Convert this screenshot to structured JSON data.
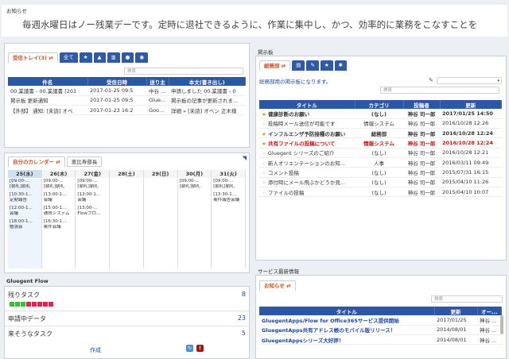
{
  "notice": {
    "label": "お知らせ",
    "message": "毎週水曜日はノー残業デーです。定時に退社できるように、作業に集中し、かつ、効率的に業務をこなすことを"
  },
  "mail": {
    "tabs": [
      "受信トレイ(3)",
      "全て"
    ],
    "icons": [
      "star-icon",
      "attach-icon",
      "trash-icon",
      "comment-icon",
      "settings-icon"
    ],
    "search_placeholder": "検索",
    "headers": [
      "件名",
      "受信日時",
      "送り主",
      "本文(書き出し)"
    ],
    "rows": [
      {
        "subject": "00.業議書 - 00.業議書 [201",
        "date": "2017-01-25 09:5",
        "from": "中谷 ...",
        "body": "申請しました 00.業議書 - 0"
      },
      {
        "subject": "掲示板 更新通知",
        "date": "2017-01-25 09:5",
        "from": "Glue...",
        "body": "掲示板の記事が更新されま..."
      },
      {
        "subject": "【外部】 通知: [未読] オベ",
        "date": "2017-01-23 16:2",
        "from": "Goog...",
        "body": "詳細 » [未読] オベン 正木様"
      }
    ]
  },
  "calendar": {
    "tabs": [
      "自分のカレンダー",
      "恵比寿部長"
    ],
    "days": [
      "25(水)",
      "26(木)",
      "27(金)",
      "28(土)",
      "29(日)",
      "30(月)",
      "31(火)"
    ],
    "events": [
      [
        "[09:00-...",
        "[朝礼]朝礼",
        "[10:30-1...",
        "定期報告",
        "[12:00-1...",
        "会議",
        "[18:00-1...",
        "勉強会"
      ],
      [
        "[09:00-...",
        "[朝礼]朝礼",
        "[13:00-1...",
        "会議",
        "[15:00-1...",
        "通貨システム",
        "[16:30-1...",
        "案件会議"
      ],
      [
        "[09:00-...",
        "[朝礼]朝礼",
        "[12:00-1...",
        "会議",
        "[13:00-...",
        "Flowプロ..."
      ],
      [],
      [],
      [
        "[09:00-...",
        "[朝礼]朝礼"
      ],
      [
        "[09:00-...",
        "[朝礼]朝礼",
        "[13:30-1...",
        "案件報告会議"
      ]
    ]
  },
  "flow": {
    "title": "Gluegent Flow",
    "remaining_label": "残りタスク",
    "remaining_count": "8",
    "pending_label": "申請中データ",
    "pending_count": "23",
    "upcoming_label": "来そうなタスク",
    "upcoming_count": "5",
    "create_label": "作成",
    "colors": {
      "green": "#3cba3c",
      "red": "#e0234e"
    },
    "squares": [
      "green",
      "green",
      "green",
      "red",
      "red",
      "red",
      "red",
      "red"
    ]
  },
  "board": {
    "title": "掲示板",
    "tabs": [
      "総務部"
    ],
    "subtitle": "総務部用の掲示板になります。",
    "search_placeholder": "検索",
    "headers": [
      "タイトル",
      "カテゴリ",
      "投稿者",
      "更新"
    ],
    "rows": [
      {
        "star": true,
        "title": "健康診断のお願い",
        "cat": "(なし)",
        "author": "神谷 司一郎",
        "date": "2017/01/25 14:50",
        "style": "bold"
      },
      {
        "star": false,
        "title": "投稿時メール送信が可能です",
        "cat": "情報システム",
        "author": "神谷 司一郎",
        "date": "2016/10/28 12:26",
        "style": ""
      },
      {
        "star": true,
        "title": "インフルエンザ予防接種のお願い",
        "cat": "総務部",
        "author": "神谷 司一郎",
        "date": "2016/10/28 12:24",
        "style": "bold"
      },
      {
        "star": true,
        "title": "共有ファイルの投稿について",
        "cat": "情報システム",
        "author": "神谷 司一郎",
        "date": "2016/10/28 12:24",
        "style": "red"
      },
      {
        "star": false,
        "title": "Gluegent シリーズのご紹介",
        "cat": "(なし)",
        "author": "神谷 司一郎",
        "date": "2016/10/28 12:21",
        "style": ""
      },
      {
        "star": false,
        "title": "新人オリエンテーションのお知...",
        "cat": "人事",
        "author": "神谷 司一郎",
        "date": "2016/03/11 09:49",
        "style": ""
      },
      {
        "star": false,
        "title": "コメント投稿",
        "cat": "(なし)",
        "author": "神谷 司一郎",
        "date": "2015/07/31 16:15",
        "style": ""
      },
      {
        "star": false,
        "title": "添付時にメール飛ぶかどうか見...",
        "cat": "(なし)",
        "author": "神谷 司一郎",
        "date": "2015/04/10 11:26",
        "style": ""
      },
      {
        "star": false,
        "title": "ファイルの投稿",
        "cat": "(なし)",
        "author": "神谷 司一郎",
        "date": "2015/04/10 10:07",
        "style": ""
      }
    ]
  },
  "service": {
    "title": "サービス最新情報",
    "tabs": [
      "お知らせ"
    ],
    "search_placeholder": "検索",
    "headers": [
      "タイトル",
      "更新",
      "オー..."
    ],
    "rows": [
      {
        "title": "GluegentApps/Flow for Office365サービス提供開始",
        "date": "2017/01/25",
        "owner": "神谷 ..."
      },
      {
        "title": "GluegentApps共有アドレス帳のモバイル版リリース！",
        "date": "2014/08/01",
        "owner": "神谷 ..."
      },
      {
        "title": "GluegentAppsシリーズ大好評！",
        "date": "2014/08/01",
        "owner": "神谷 ..."
      }
    ]
  }
}
